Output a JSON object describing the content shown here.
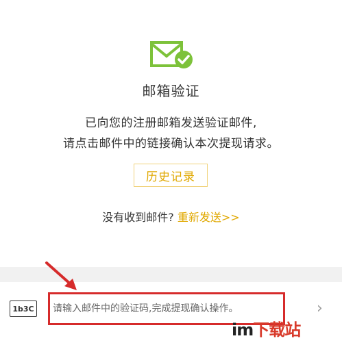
{
  "page": {
    "title": "邮箱验证",
    "description_line1": "已向您的注册邮箱发送验证邮件,",
    "description_line2": "请点击邮件中的链接确认本次提现请求。",
    "history_button_label": "历史记录",
    "not_received_text": "没有收到邮件?",
    "resend_label": "重新发送>>"
  },
  "code_entry": {
    "icon_text": "1b3C",
    "placeholder": "请输入邮件中的验证码,完成提现确认操作。",
    "chevron": "›"
  },
  "watermark": {
    "part1": "im",
    "part2": "下载站"
  },
  "colors": {
    "accent": "#e0a800",
    "icon_green": "#7dc23a",
    "highlight_red": "#d62b2b"
  },
  "icons": [
    "mail-check-icon",
    "verification-code-icon",
    "chevron-right-icon",
    "annotation-arrow-icon"
  ]
}
